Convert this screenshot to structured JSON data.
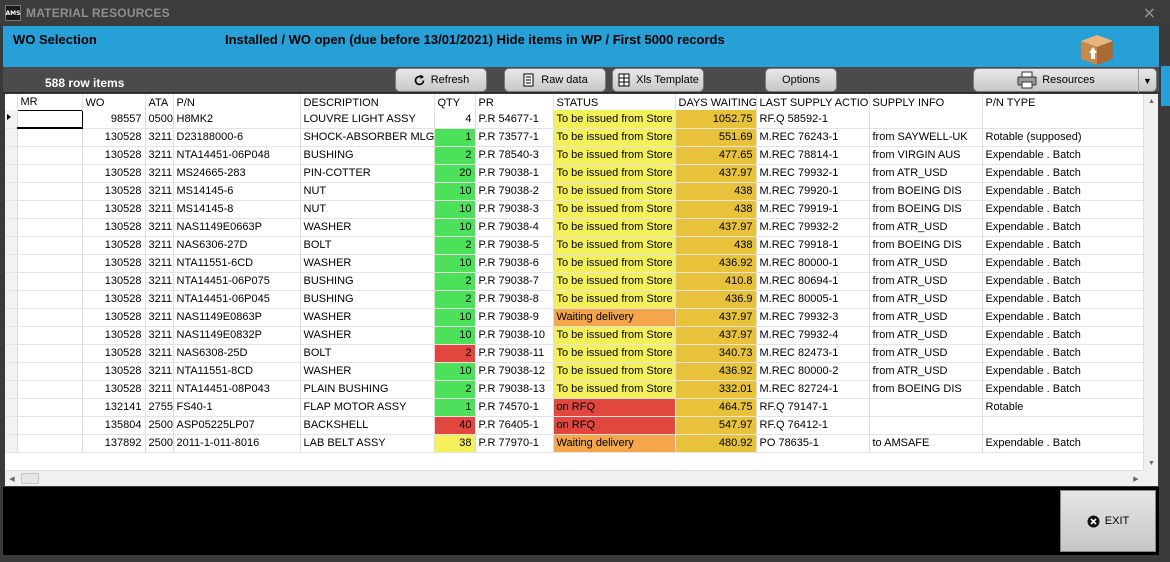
{
  "window": {
    "logo_text": "AMS",
    "title": "MATERIAL RESOURCES",
    "close_glyph": "×",
    "accent_color": "#27a0d8"
  },
  "header": {
    "wo_selection": "WO Selection",
    "filter_text": "Installed / WO open (due before 13/01/2021) Hide items in WP / First 5000 records",
    "icon": "box-upload-icon"
  },
  "toolbar": {
    "row_count": "588 row items",
    "refresh": "Refresh",
    "raw_data": "Raw data",
    "xls_template": "Xls Template",
    "options": "Options",
    "resources": "Resources"
  },
  "grid": {
    "columns": [
      "MR",
      "WO",
      "ATA",
      "P/N",
      "DESCRIPTION",
      "QTY",
      "PR",
      "STATUS",
      "DAYS WAITING",
      "LAST SUPPLY ACTION",
      "SUPPLY INFO",
      "P/N TYPE"
    ],
    "status_colors": {
      "To be issued from Store": "#f4f05a",
      "Waiting delivery": "#f5a64a",
      "on RFQ": "#e2473f"
    },
    "qty_colors": {
      "green": "#4de05a",
      "red": "#e2473f",
      "yellow": "#f4f05a",
      "white": "#ffffff"
    },
    "days_color": "#e7c23a",
    "rows": [
      {
        "mr": "",
        "wo": "98557",
        "ata": "0500",
        "pn": "H8MK2",
        "desc": "LOUVRE LIGHT ASSY",
        "qty": "4",
        "qty_color": "white",
        "pr": "P.R 54677-1",
        "status": "To be issued from Store",
        "days": "1052.75",
        "last": "RF.Q 58592-1",
        "info": "",
        "type": ""
      },
      {
        "mr": "",
        "wo": "130528",
        "ata": "3211",
        "pn": "D23188000-6",
        "desc": "SHOCK-ABSORBER MLG",
        "qty": "1",
        "qty_color": "green",
        "pr": "P.R 73577-1",
        "status": "To be issued from Store",
        "days": "551.69",
        "last": "M.REC 76243-1",
        "info": "from SAYWELL-UK",
        "type": "Rotable (supposed)"
      },
      {
        "mr": "",
        "wo": "130528",
        "ata": "3211",
        "pn": "NTA14451-06P048",
        "desc": "BUSHING",
        "qty": "2",
        "qty_color": "green",
        "pr": "P.R 78540-3",
        "status": "To be issued from Store",
        "days": "477.65",
        "last": "M.REC 78814-1",
        "info": "from VIRGIN AUS",
        "type": "Expendable . Batch"
      },
      {
        "mr": "",
        "wo": "130528",
        "ata": "3211",
        "pn": "MS24665-283",
        "desc": "PIN-COTTER",
        "qty": "20",
        "qty_color": "green",
        "pr": "P.R 79038-1",
        "status": "To be issued from Store",
        "days": "437.97",
        "last": "M.REC 79932-1",
        "info": "from ATR_USD",
        "type": "Expendable . Batch"
      },
      {
        "mr": "",
        "wo": "130528",
        "ata": "3211",
        "pn": "MS14145-6",
        "desc": "NUT",
        "qty": "10",
        "qty_color": "green",
        "pr": "P.R 79038-2",
        "status": "To be issued from Store",
        "days": "438",
        "last": "M.REC 79920-1",
        "info": "from BOEING DIS",
        "type": "Expendable . Batch"
      },
      {
        "mr": "",
        "wo": "130528",
        "ata": "3211",
        "pn": "MS14145-8",
        "desc": "NUT",
        "qty": "10",
        "qty_color": "green",
        "pr": "P.R 79038-3",
        "status": "To be issued from Store",
        "days": "438",
        "last": "M.REC 79919-1",
        "info": "from BOEING DIS",
        "type": "Expendable . Batch"
      },
      {
        "mr": "",
        "wo": "130528",
        "ata": "3211",
        "pn": "NAS1149E0663P",
        "desc": "WASHER",
        "qty": "10",
        "qty_color": "green",
        "pr": "P.R 79038-4",
        "status": "To be issued from Store",
        "days": "437.97",
        "last": "M.REC 79932-2",
        "info": "from ATR_USD",
        "type": "Expendable . Batch"
      },
      {
        "mr": "",
        "wo": "130528",
        "ata": "3211",
        "pn": "NAS6306-27D",
        "desc": "BOLT",
        "qty": "2",
        "qty_color": "green",
        "pr": "P.R 79038-5",
        "status": "To be issued from Store",
        "days": "438",
        "last": "M.REC 79918-1",
        "info": "from BOEING DIS",
        "type": "Expendable . Batch"
      },
      {
        "mr": "",
        "wo": "130528",
        "ata": "3211",
        "pn": "NTA11551-6CD",
        "desc": "WASHER",
        "qty": "10",
        "qty_color": "green",
        "pr": "P.R 79038-6",
        "status": "To be issued from Store",
        "days": "436.92",
        "last": "M.REC 80000-1",
        "info": "from ATR_USD",
        "type": "Expendable . Batch"
      },
      {
        "mr": "",
        "wo": "130528",
        "ata": "3211",
        "pn": "NTA14451-06P075",
        "desc": "BUSHING",
        "qty": "2",
        "qty_color": "green",
        "pr": "P.R 79038-7",
        "status": "To be issued from Store",
        "days": "410.8",
        "last": "M.REC 80694-1",
        "info": "from ATR_USD",
        "type": "Expendable . Batch"
      },
      {
        "mr": "",
        "wo": "130528",
        "ata": "3211",
        "pn": "NTA14451-06P045",
        "desc": "BUSHING",
        "qty": "2",
        "qty_color": "green",
        "pr": "P.R 79038-8",
        "status": "To be issued from Store",
        "days": "436.9",
        "last": "M.REC 80005-1",
        "info": "from ATR_USD",
        "type": "Expendable . Batch"
      },
      {
        "mr": "",
        "wo": "130528",
        "ata": "3211",
        "pn": "NAS1149E0863P",
        "desc": "WASHER",
        "qty": "10",
        "qty_color": "green",
        "pr": "P.R 79038-9",
        "status": "Waiting delivery",
        "days": "437.97",
        "last": "M.REC 79932-3",
        "info": "from ATR_USD",
        "type": "Expendable . Batch"
      },
      {
        "mr": "",
        "wo": "130528",
        "ata": "3211",
        "pn": "NAS1149E0832P",
        "desc": "WASHER",
        "qty": "10",
        "qty_color": "green",
        "pr": "P.R 79038-10",
        "status": "To be issued from Store",
        "days": "437.97",
        "last": "M.REC 79932-4",
        "info": "from ATR_USD",
        "type": "Expendable . Batch"
      },
      {
        "mr": "",
        "wo": "130528",
        "ata": "3211",
        "pn": "NAS6308-25D",
        "desc": "BOLT",
        "qty": "2",
        "qty_color": "red",
        "pr": "P.R 79038-11",
        "status": "To be issued from Store",
        "days": "340.73",
        "last": "M.REC 82473-1",
        "info": "from ATR_USD",
        "type": "Expendable . Batch"
      },
      {
        "mr": "",
        "wo": "130528",
        "ata": "3211",
        "pn": "NTA11551-8CD",
        "desc": "WASHER",
        "qty": "10",
        "qty_color": "green",
        "pr": "P.R 79038-12",
        "status": "To be issued from Store",
        "days": "436.92",
        "last": "M.REC 80000-2",
        "info": "from ATR_USD",
        "type": "Expendable . Batch"
      },
      {
        "mr": "",
        "wo": "130528",
        "ata": "3211",
        "pn": "NTA14451-08P043",
        "desc": "PLAIN BUSHING",
        "qty": "2",
        "qty_color": "green",
        "pr": "P.R 79038-13",
        "status": "To be issued from Store",
        "days": "332.01",
        "last": "M.REC 82724-1",
        "info": "from BOEING DIS",
        "type": "Expendable . Batch"
      },
      {
        "mr": "",
        "wo": "132141",
        "ata": "2755",
        "pn": "FS40-1",
        "desc": "FLAP MOTOR ASSY",
        "qty": "1",
        "qty_color": "green",
        "pr": "P.R 74570-1",
        "status": "on RFQ",
        "days": "464.75",
        "last": "RF.Q 79147-1",
        "info": "",
        "type": "Rotable"
      },
      {
        "mr": "",
        "wo": "135804",
        "ata": "2500",
        "pn": "ASP05225LP07",
        "desc": "BACKSHELL",
        "qty": "40",
        "qty_color": "red",
        "pr": "P.R 76405-1",
        "status": "on RFQ",
        "days": "547.97",
        "last": "RF.Q 76412-1",
        "info": "",
        "type": ""
      },
      {
        "mr": "",
        "wo": "137892",
        "ata": "2500",
        "pn": "2011-1-011-8016",
        "desc": "LAB BELT ASSY",
        "qty": "38",
        "qty_color": "yellow",
        "pr": "P.R 77970-1",
        "status": "Waiting delivery",
        "days": "480.92",
        "last": "PO 78635-1",
        "info": "to AMSAFE",
        "type": "Expendable . Batch"
      }
    ]
  },
  "footer": {
    "exit": "EXIT"
  }
}
